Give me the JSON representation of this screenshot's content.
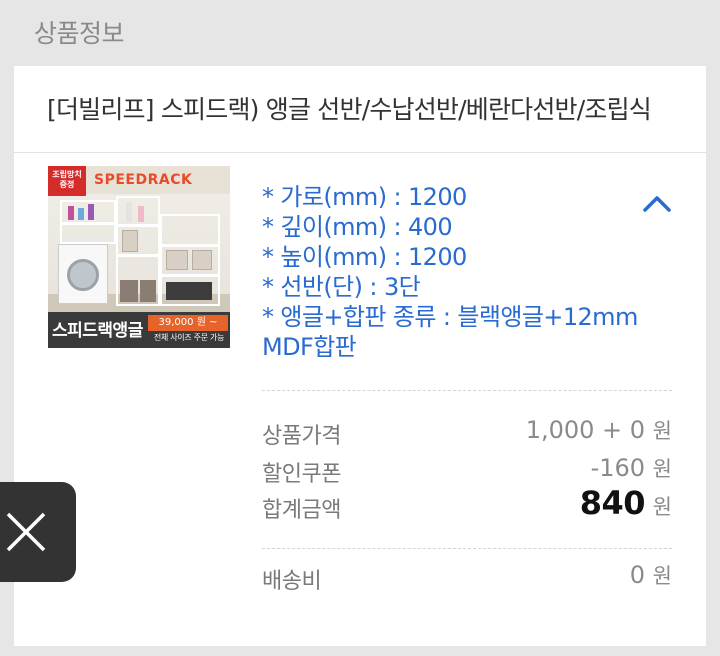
{
  "section": {
    "title": "상품정보"
  },
  "product": {
    "name": "[더빌리프] 스피드랙) 앵글 선반/수납선반/베란다선반/조립식",
    "thumbnail": {
      "badge": "조립망치 증정",
      "brand": "SPEEDRACK",
      "label": "스피드랙앵글",
      "price": "39,000 원 ~",
      "note": "전체 사이즈 주문 가능"
    },
    "options": [
      "* 가로(mm) : 1200",
      "* 깊이(mm) : 400",
      "* 높이(mm) : 1200",
      "* 선반(단) : 3단",
      "* 앵글+합판 종류 : 블랙앵글+12mm MDF합판"
    ],
    "collapse_icon": "chevron-up-icon"
  },
  "pricing": {
    "product_price_label": "상품가격",
    "product_price_value": "1,000 + 0",
    "discount_label": "할인쿠폰",
    "discount_value": "-160",
    "total_label": "합계금액",
    "total_value": "840",
    "shipping_label": "배송비",
    "shipping_value": "0",
    "currency": "원"
  },
  "floating": {
    "close_icon": "close-icon"
  },
  "colors": {
    "accent": "#2a6bd1",
    "background": "#e6e6e6",
    "card": "#ffffff",
    "float_button": "#333333"
  }
}
